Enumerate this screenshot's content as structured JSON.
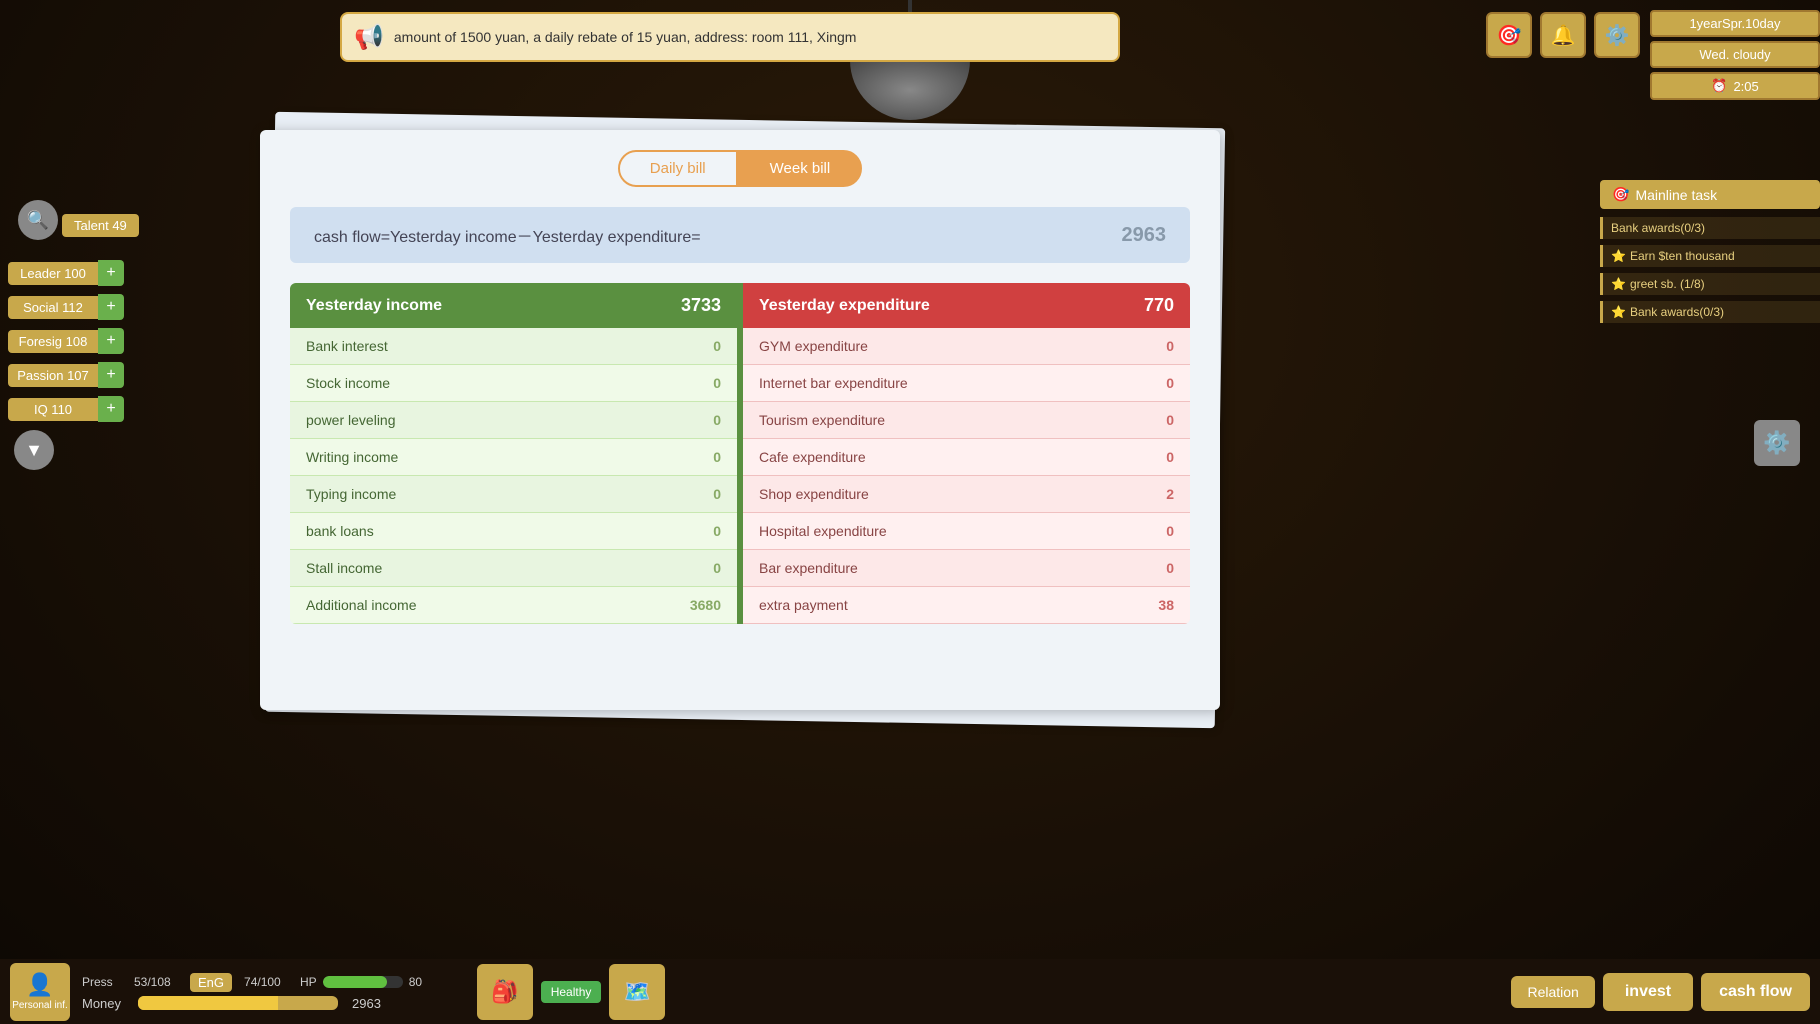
{
  "announcement": {
    "text": "amount of 1500 yuan, a daily rebate of 15 yuan, address: room 111, Xingm",
    "megaphone": "📢"
  },
  "topRight": {
    "date": "1yearSpr.10day",
    "weekday": "Wed.   cloudy",
    "time": "2:05",
    "clockIcon": "⏰",
    "icons": [
      "🎯",
      "🔔",
      "⚙️"
    ]
  },
  "sidebar": {
    "talent": "49",
    "talentLabel": "Talent",
    "stats": [
      {
        "label": "Leader 100",
        "plus": "+"
      },
      {
        "label": "Social  112",
        "plus": "+"
      },
      {
        "label": "Foresig 108",
        "plus": "+"
      },
      {
        "label": "Passion 107",
        "plus": "+"
      },
      {
        "label": "IQ     110",
        "plus": "+"
      }
    ]
  },
  "mainlineTask": {
    "title": "Mainline task",
    "icon": "🎯",
    "items": [
      {
        "label": "Bank awards(0/3)"
      },
      {
        "star": true,
        "label": "Earn $ten thousand"
      },
      {
        "star": true,
        "label": "greet sb. (1/8)"
      },
      {
        "star": true,
        "label": "Bank awards(0/3)"
      }
    ]
  },
  "bill": {
    "tabs": [
      {
        "label": "Daily bill",
        "active": false
      },
      {
        "label": "Week bill",
        "active": true
      }
    ],
    "cashFlow": {
      "formula": "cash flow=Yesterday income－Yesterday expenditure=",
      "value": "2963"
    },
    "income": {
      "header": "Yesterday income",
      "total": "3733",
      "rows": [
        {
          "label": "Bank interest",
          "value": "0"
        },
        {
          "label": "Stock income",
          "value": "0"
        },
        {
          "label": "power leveling",
          "value": "0"
        },
        {
          "label": "Writing income",
          "value": "0"
        },
        {
          "label": "Typing income",
          "value": "0"
        },
        {
          "label": "bank loans",
          "value": "0"
        },
        {
          "label": "Stall income",
          "value": "0"
        },
        {
          "label": "Additional income",
          "value": "3680"
        }
      ]
    },
    "expenditure": {
      "header": "Yesterday expenditure",
      "total": "770",
      "rows": [
        {
          "label": "GYM expenditure",
          "value": "0"
        },
        {
          "label": "Internet bar expenditure",
          "value": "0"
        },
        {
          "label": "Tourism expenditure",
          "value": "0"
        },
        {
          "label": "Cafe expenditure",
          "value": "0"
        },
        {
          "label": "Shop expenditure",
          "value": "2"
        },
        {
          "label": "Hospital expenditure",
          "value": "0"
        },
        {
          "label": "Bar expenditure",
          "value": "0"
        },
        {
          "label": "extra payment",
          "value": "38"
        }
      ]
    }
  },
  "bottomBar": {
    "personalInfo": "Personal inf.",
    "press": {
      "label": "Press",
      "current": "53",
      "max": "108"
    },
    "eng": {
      "label": "EnG",
      "current": "74",
      "max": "100"
    },
    "hp": {
      "label": "HP",
      "current": "80"
    },
    "money": {
      "label": "Money",
      "value": "2963"
    },
    "healthStatus": "Healthy",
    "relation": "Relation",
    "invest": "invest",
    "cashFlow": "cash flow"
  }
}
